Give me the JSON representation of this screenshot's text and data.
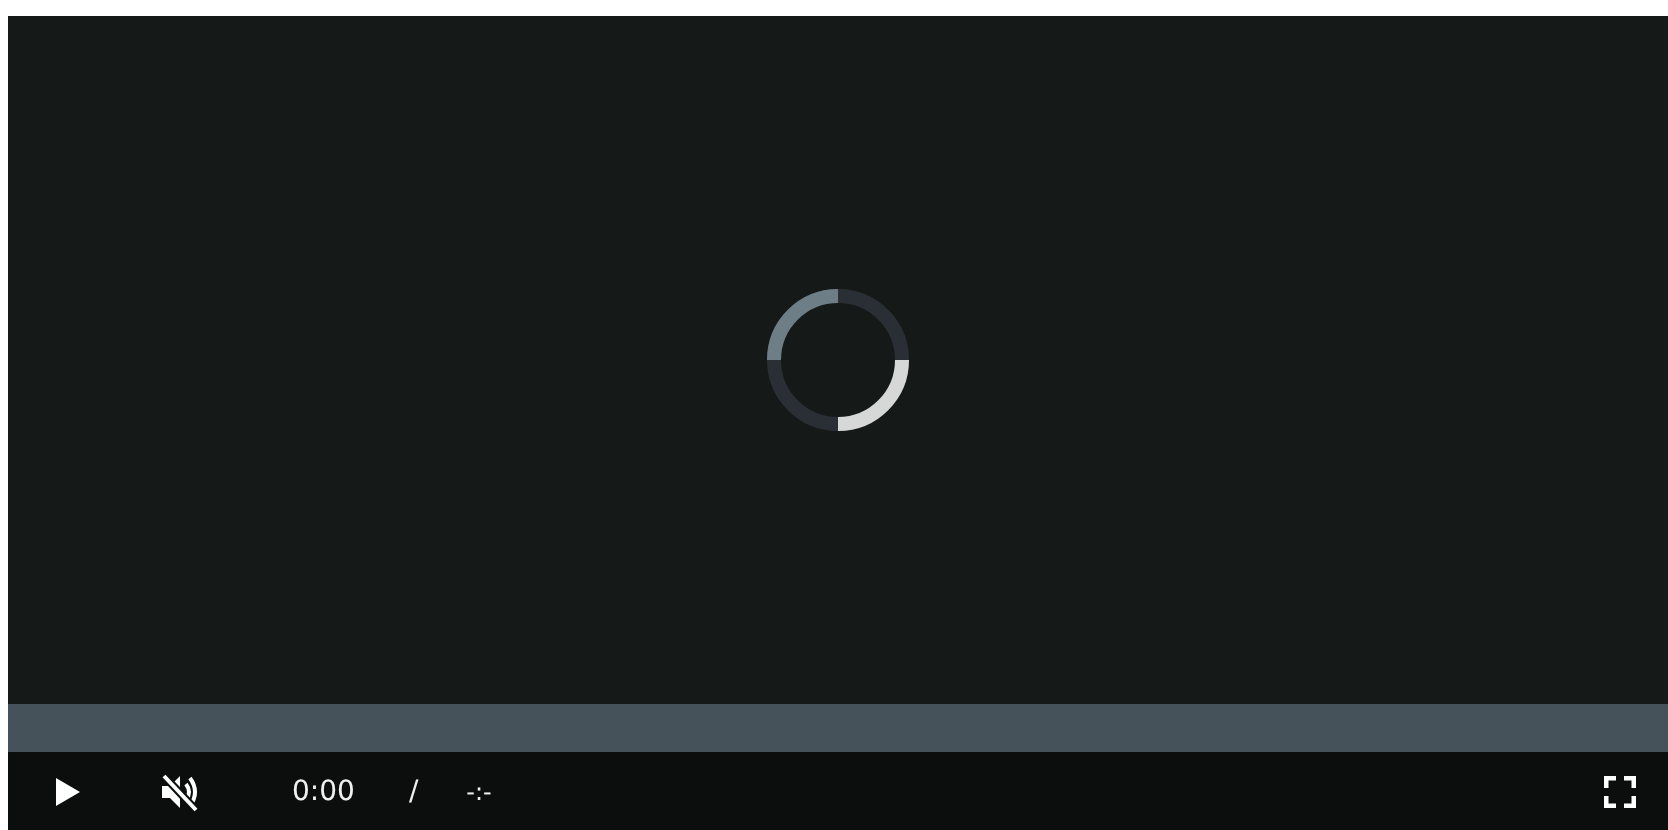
{
  "player": {
    "playing": false,
    "muted": true,
    "loading": true,
    "seek": {
      "level": 0
    },
    "current_time": "0:00",
    "separator": "/",
    "duration": "-:-"
  }
}
